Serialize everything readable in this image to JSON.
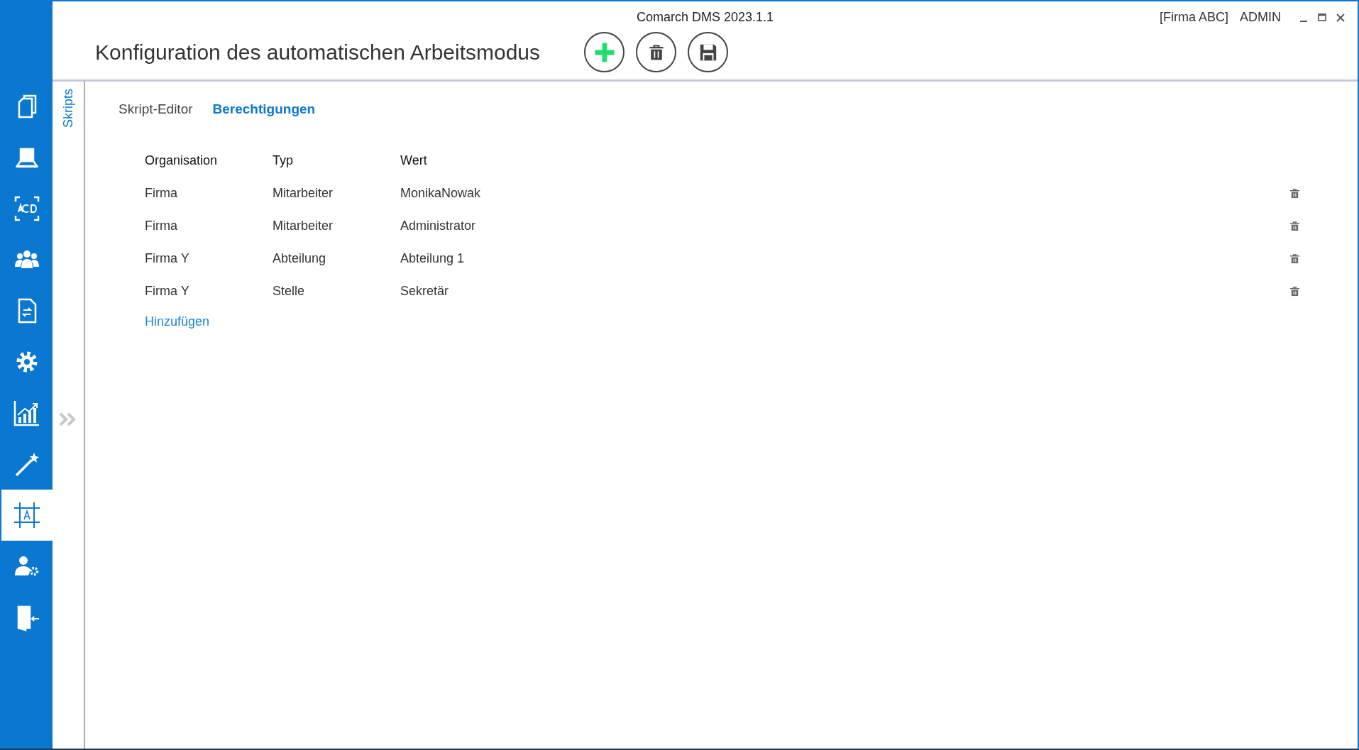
{
  "window": {
    "app_title": "Comarch DMS 2023.1.1",
    "company": "[Firma ABC]",
    "user": "ADMIN"
  },
  "sidebar": {
    "items": [
      {
        "kind": "documents",
        "selected": false
      },
      {
        "kind": "scanner",
        "selected": false
      },
      {
        "kind": "ocr",
        "selected": false
      },
      {
        "kind": "users",
        "selected": false
      },
      {
        "kind": "workflow",
        "selected": false
      },
      {
        "kind": "settings",
        "selected": false
      },
      {
        "kind": "chart",
        "selected": false
      },
      {
        "kind": "wand",
        "selected": false
      },
      {
        "kind": "designer",
        "selected": true
      },
      {
        "kind": "user-settings",
        "selected": false
      },
      {
        "kind": "exit",
        "selected": false
      }
    ]
  },
  "header": {
    "title": "Konfiguration des automatischen Arbeitsmodus",
    "toolbar": [
      {
        "kind": "add"
      },
      {
        "kind": "delete"
      },
      {
        "kind": "save"
      }
    ]
  },
  "side_tabs": [
    {
      "label": "Skripts",
      "selected": true
    }
  ],
  "tabs": [
    {
      "label": "Skript-Editor",
      "selected": false
    },
    {
      "label": "Berechtigungen",
      "selected": true
    }
  ],
  "table": {
    "columns": [
      "Organisation",
      "Typ",
      "Wert"
    ],
    "rows": [
      [
        "Firma",
        "Mitarbeiter",
        "MonikaNowak"
      ],
      [
        "Firma",
        "Mitarbeiter",
        "Administrator"
      ],
      [
        "Firma Y",
        "Abteilung",
        "Abteilung 1"
      ],
      [
        "Firma Y",
        "Stelle",
        "Sekretär"
      ]
    ],
    "add_link": "Hinzufügen"
  }
}
